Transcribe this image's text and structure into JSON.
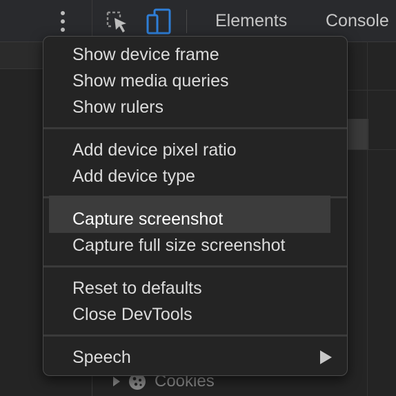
{
  "toolbar": {
    "tabs": [
      {
        "label": "Elements"
      },
      {
        "label": "Console"
      }
    ],
    "accent_color": "#2f7fd8"
  },
  "tree": {
    "cookies_label": "Cookies"
  },
  "menu": {
    "groups": [
      {
        "items": [
          {
            "label": "Show device frame"
          },
          {
            "label": "Show media queries"
          },
          {
            "label": "Show rulers"
          }
        ]
      },
      {
        "items": [
          {
            "label": "Add device pixel ratio"
          },
          {
            "label": "Add device type"
          }
        ]
      },
      {
        "items": [
          {
            "label": "Capture screenshot"
          },
          {
            "label": "Capture full size screenshot"
          }
        ]
      },
      {
        "items": [
          {
            "label": "Reset to defaults"
          },
          {
            "label": "Close DevTools"
          }
        ]
      },
      {
        "items": [
          {
            "label": "Speech",
            "has_submenu": true
          }
        ]
      }
    ],
    "highlighted_item": "Capture screenshot"
  }
}
